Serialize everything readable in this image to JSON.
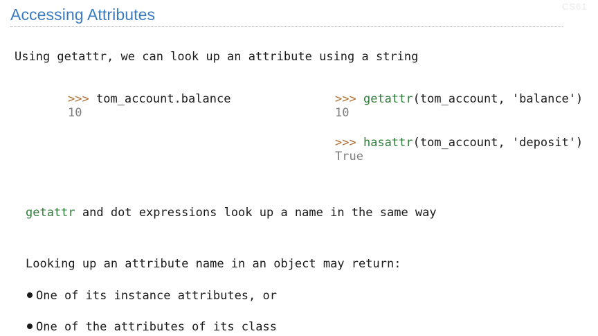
{
  "slide": {
    "title": "Accessing Attributes",
    "watermark": "CS61",
    "intro": "Using getattr, we can look up an attribute using a string",
    "left_example": {
      "prompt": ">>>",
      "expr": "tom_account.balance",
      "output": "10"
    },
    "right_example_1": {
      "prompt": ">>>",
      "fn": "getattr",
      "args": "(tom_account, 'balance')",
      "output": "10"
    },
    "right_example_2": {
      "prompt": ">>>",
      "fn": "hasattr",
      "args": "(tom_account, 'deposit')",
      "output": "True"
    },
    "note": {
      "fn": "getattr",
      "rest": " and dot expressions look up a name in the same way"
    },
    "lookup_heading": "Looking up an attribute name in an object may return:",
    "bullets": [
      "One of its instance attributes, or",
      "One of the attributes of its class"
    ]
  }
}
